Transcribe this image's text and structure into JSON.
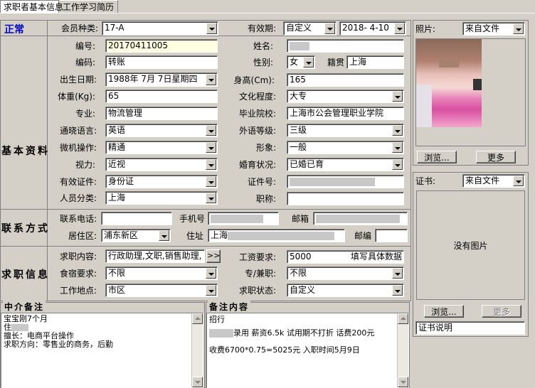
{
  "tabs": [
    "求职者基本信息",
    "工作学习简历"
  ],
  "status": "正常",
  "sections": {
    "basic": "基本资料",
    "contact": "联系方式",
    "job": "求职信息"
  },
  "labels": {
    "member_type": "会员种类:",
    "valid": "有效期:",
    "number": "编号:",
    "name": "姓名:",
    "code": "编码:",
    "gender": "性别:",
    "native": "籍贯",
    "birth": "出生日期:",
    "height": "身高(Cm):",
    "weight": "体重(Kg):",
    "edu": "文化程度:",
    "major": "专业:",
    "school": "毕业院校:",
    "lang": "通晓语言:",
    "lang_level": "外语等级:",
    "computer": "微机操作:",
    "appearance": "形象:",
    "vision": "视力:",
    "marital": "婚育状况:",
    "id_type": "有效证件:",
    "id_no": "证件号:",
    "category": "人员分类:",
    "title": "职称:",
    "phone": "联系电话:",
    "mobile": "手机号",
    "email": "邮箱",
    "district": "居住区:",
    "address": "住址",
    "zip": "邮编",
    "job_content": "求职内容:",
    "salary": "工资要求:",
    "board": "食宿要求:",
    "fulltime": "专/兼职:",
    "location": "工作地点:",
    "job_status": "求职状态:",
    "photo": "照片:",
    "cert": "证书:"
  },
  "values": {
    "member_type": "17-A",
    "valid_mode": "自定义",
    "valid_date": "2018- 4-10",
    "number": "20170411005",
    "code": "转账",
    "gender": "女",
    "native": "上海",
    "birth": "1988年 7月 7日星期四",
    "height": "165",
    "weight": "65",
    "edu": "大专",
    "major": "物流管理",
    "school": "上海市公会管理职业学院",
    "lang": "英语",
    "lang_level": "三级",
    "computer": "精通",
    "appearance": "一般",
    "vision": "近视",
    "marital": "已婚已育",
    "id_type": "身份证",
    "category": "上海",
    "phone": "",
    "district": "浦东新区",
    "address_prefix": "上海",
    "zip": "",
    "job_content": "行政助理,文职,销售助理,",
    "more_btn": ">>",
    "salary": "5000",
    "salary_note": "填写具体数据",
    "board": "不限",
    "fulltime": "不限",
    "location": "市区",
    "job_status": "自定义",
    "photo_src": "来自文件",
    "cert_src": "来自文件",
    "no_image": "没有图片",
    "cert_desc": "证书说明"
  },
  "buttons": {
    "browse": "浏览...",
    "more": "更多"
  },
  "memo": {
    "agent_title": "中介备注",
    "agent_lines": [
      "宝宝刚7个月",
      "住",
      "擅长：电商平台操作",
      "求职方向：零售业的商务，后勤"
    ],
    "remark_title": "备注内容",
    "remark_lines": [
      "招行",
      "录用 薪资6.5k 试用期不打折 话费200元",
      "收费6700*0.75=5025元 入职时间5月9日"
    ]
  }
}
